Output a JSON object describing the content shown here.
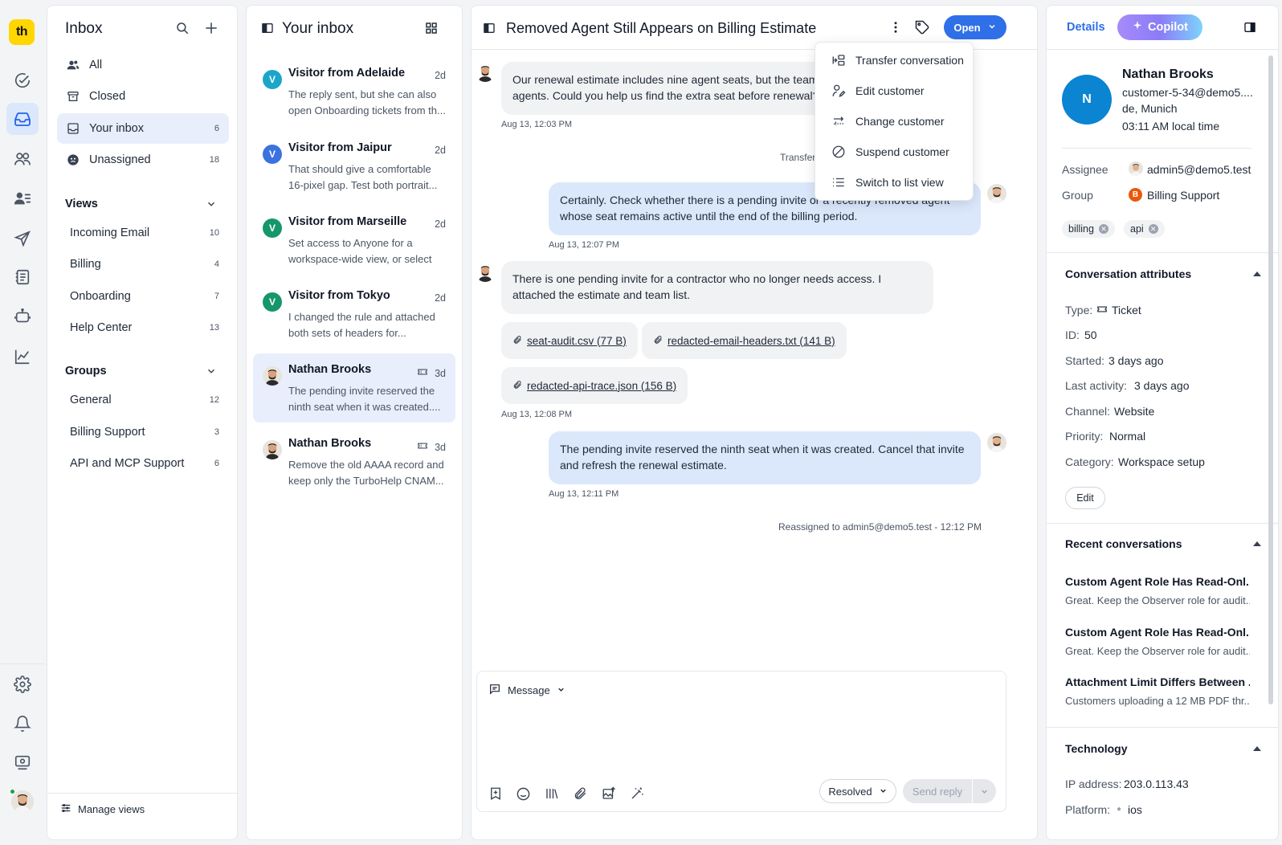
{
  "rail": {
    "logo": "th"
  },
  "nav": {
    "title": "Inbox",
    "items": [
      {
        "label": "All",
        "count": ""
      },
      {
        "label": "Closed",
        "count": ""
      },
      {
        "label": "Your inbox",
        "count": "6"
      },
      {
        "label": "Unassigned",
        "count": "18"
      }
    ],
    "views_title": "Views",
    "views": [
      {
        "label": "Incoming Email",
        "count": "10"
      },
      {
        "label": "Billing",
        "count": "4"
      },
      {
        "label": "Onboarding",
        "count": "7"
      },
      {
        "label": "Help Center",
        "count": "13"
      }
    ],
    "groups_title": "Groups",
    "groups": [
      {
        "label": "General",
        "count": "12"
      },
      {
        "label": "Billing Support",
        "count": "3"
      },
      {
        "label": "API and MCP Support",
        "count": "6"
      }
    ],
    "manage_views": "Manage views"
  },
  "list": {
    "title": "Your inbox",
    "items": [
      {
        "initial": "V",
        "color": "#1ba6c9",
        "name": "Visitor from Adelaide",
        "time": "2d",
        "preview": "The reply sent, but she can also open Onboarding tickets from th..."
      },
      {
        "initial": "V",
        "color": "#3b72e0",
        "name": "Visitor from Jaipur",
        "time": "2d",
        "preview": "That should give a comfortable 16-pixel gap. Test both portrait..."
      },
      {
        "initial": "V",
        "color": "#16966b",
        "name": "Visitor from Marseille",
        "time": "2d",
        "preview": "Set access to Anyone for a workspace-wide view, or select t..."
      },
      {
        "initial": "V",
        "color": "#16966b",
        "name": "Visitor from Tokyo",
        "time": "2d",
        "preview": "I changed the rule and attached both sets of headers for..."
      },
      {
        "initial": "",
        "color": "",
        "name": "Nathan Brooks",
        "time": "3d",
        "preview": "The pending invite reserved the ninth seat when it was created...."
      },
      {
        "initial": "",
        "color": "",
        "name": "Nathan Brooks",
        "time": "3d",
        "preview": "Remove the old AAAA record and keep only the TurboHelp CNAM..."
      }
    ]
  },
  "conversation": {
    "title": "Removed Agent Still Appears on Billing Estimate",
    "status_button": "Open",
    "messages": [
      {
        "text": "Our renewal estimate includes nine agent seats, but the team only has eight active agents. Could you help us find the extra seat before renewal?",
        "time": "Aug 13, 12:03 PM"
      },
      {
        "text": "Transferred to Billing Support - 12:05 PM"
      },
      {
        "text": "Certainly. Check whether there is a pending invite or a recently removed agent whose seat remains active until the end of the billing period.",
        "time": "Aug 13, 12:07 PM"
      },
      {
        "text": "There is one pending invite for a contractor who no longer needs access. I attached the estimate and team list.",
        "time": "Aug 13, 12:08 PM"
      },
      {
        "text": "The pending invite reserved the ninth seat when it was created. Cancel that invite and refresh the renewal estimate.",
        "time": "Aug 13, 12:11 PM"
      }
    ],
    "attachments": [
      "seat-audit.csv (77 B)",
      "redacted-email-headers.txt (141 B)",
      "redacted-api-trace.json (156 B)"
    ],
    "system_note": "Reassigned to admin5@demo5.test - 12:12 PM"
  },
  "menu": {
    "items": [
      "Transfer conversation",
      "Edit customer",
      "Change customer",
      "Suspend customer",
      "Switch to list view"
    ]
  },
  "composer": {
    "mode": "Message",
    "status_select": "Resolved",
    "send": "Send reply"
  },
  "details": {
    "tab_details": "Details",
    "tab_copilot": "Copilot",
    "customer": {
      "initial": "N",
      "name": "Nathan Brooks",
      "email": "customer-5-34@demo5....",
      "location": "de, Munich",
      "local_time": "03:11 AM local time"
    },
    "assignee_label": "Assignee",
    "assignee": "admin5@demo5.test",
    "group_label": "Group",
    "group_initial": "B",
    "group": "Billing Support",
    "tags": [
      "billing",
      "api"
    ],
    "attributes_title": "Conversation attributes",
    "attributes": [
      {
        "label": "Type:",
        "value": "Ticket"
      },
      {
        "label": "ID:",
        "value": "50"
      },
      {
        "label": "Started:",
        "value": "3 days ago"
      },
      {
        "label": "Last activity:",
        "value": "3 days ago"
      },
      {
        "label": "Channel:",
        "value": "Website"
      },
      {
        "label": "Priority:",
        "value": "Normal"
      },
      {
        "label": "Category:",
        "value": "Workspace setup"
      }
    ],
    "edit_button": "Edit",
    "recent_title": "Recent conversations",
    "recent": [
      {
        "title": "Custom Agent Role Has Read-Onl...",
        "preview": "Great. Keep the Observer role for audit..."
      },
      {
        "title": "Custom Agent Role Has Read-Onl...",
        "preview": "Great. Keep the Observer role for audit..."
      },
      {
        "title": "Attachment Limit Differs Between ...",
        "preview": "Customers uploading a 12 MB PDF thr..."
      }
    ],
    "tech_title": "Technology",
    "tech": [
      {
        "label": "IP address:",
        "value": "203.0.113.43"
      },
      {
        "label": "Platform:",
        "value": "ios"
      }
    ]
  }
}
